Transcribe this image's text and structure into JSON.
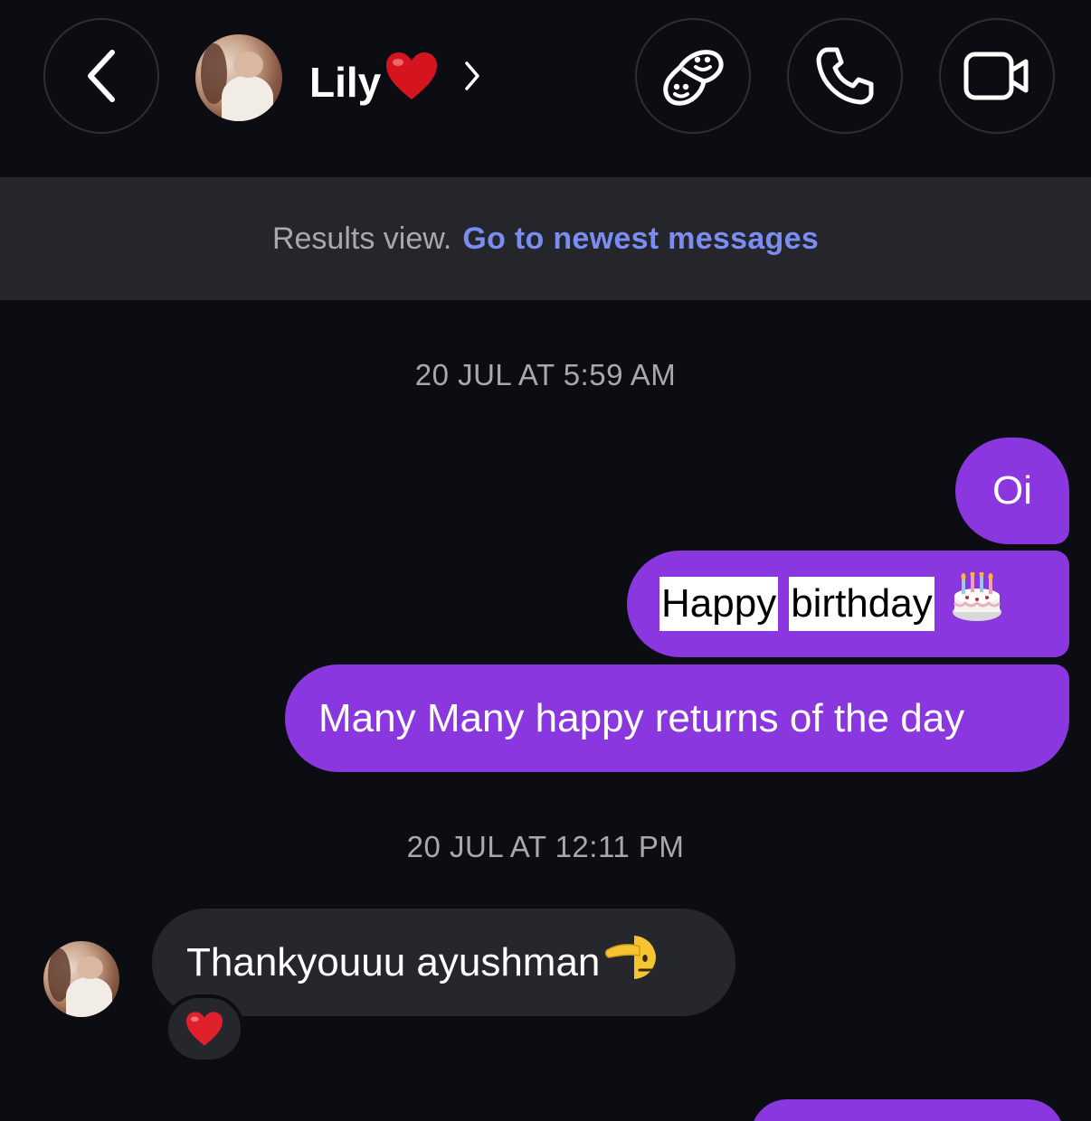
{
  "header": {
    "contact_name": "Lily",
    "icons": {
      "back": "chevron-left-icon",
      "name_suffix": "red-heart-icon",
      "profile": "chevron-right-icon",
      "stickers": "sticker-faces-icon",
      "call": "phone-icon",
      "video": "video-camera-icon"
    }
  },
  "banner": {
    "text": "Results view.",
    "link": "Go to newest messages"
  },
  "thread": {
    "timestamp_1": "20 JUL AT 5:59 AM",
    "outgoing": {
      "message_1": "Oi",
      "message_2_word_1": "Happy",
      "message_2_word_2": "birthday",
      "message_3": "Many Many happy returns of the day"
    },
    "timestamp_2": "20 JUL AT 12:11 PM",
    "incoming": {
      "message_1": "Thankyouuu ayushman"
    }
  },
  "colors": {
    "background": "#0b0d12",
    "outgoing_bubble": "#8a37e0",
    "incoming_bubble": "#25272d",
    "banner": "#24262c",
    "link": "#7b8cf3"
  }
}
